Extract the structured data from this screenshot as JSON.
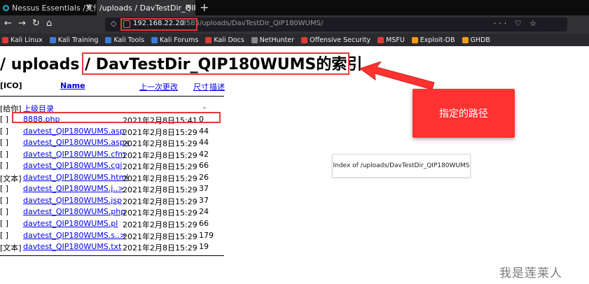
{
  "browser": {
    "tabs": [
      {
        "title": "Nessus Essentials /文件"
      },
      {
        "title": "/uploads / DavTestDir_QIP"
      }
    ],
    "url": {
      "host": "192.168.22.20",
      "rest": ":8585/uploads/DavTestDir_QIP180WUMS/"
    },
    "url_actions": "··· ♡ ☆",
    "bookmarks": [
      {
        "label": "Kali Linux",
        "color": "#e53935"
      },
      {
        "label": "Kali Training",
        "color": "#3b7ddd"
      },
      {
        "label": "Kali Tools",
        "color": "#3b7ddd"
      },
      {
        "label": "Kali Forums",
        "color": "#3b7ddd"
      },
      {
        "label": "Kali Docs",
        "color": "#e53935"
      },
      {
        "label": "NetHunter",
        "color": "#888888"
      },
      {
        "label": "Offensive Security",
        "color": "#e53935"
      },
      {
        "label": "MSFU",
        "color": "#e53935"
      },
      {
        "label": "Exploit-DB",
        "color": "#f39c12"
      },
      {
        "label": "GHDB",
        "color": "#f39c12"
      }
    ]
  },
  "page": {
    "heading": "/ uploads / DavTestDir_QIP180WUMS的索引",
    "columns": {
      "ico": "[ICO]",
      "name": "Name",
      "modified": "上一次更改",
      "size": "尺寸",
      "desc": "描述"
    },
    "parent": {
      "icon": "[给你]",
      "name": "上级目录",
      "size": "-"
    },
    "rows": [
      {
        "icon": "[ ]",
        "name": "8888.php",
        "date": "2021年2月8日15:41",
        "size": "0"
      },
      {
        "icon": "[ ]",
        "name": "davtest_QIP180WUMS.asp",
        "date": "2021年2月8日15:29",
        "size": "44"
      },
      {
        "icon": "[ ]",
        "name": "davtest_QIP180WUMS.aspx",
        "date": "2021年2月8日15:29",
        "size": "44"
      },
      {
        "icon": "[ ]",
        "name": "davtest_QIP180WUMS.cfm",
        "date": "2021年2月8日15:29",
        "size": "42"
      },
      {
        "icon": "[ ]",
        "name": "davtest_QIP180WUMS.cgi",
        "date": "2021年2月8日15:29",
        "size": "66"
      },
      {
        "icon": "[文本]",
        "name": "davtest_QIP180WUMS.html",
        "date": "2021年2月8日15:29",
        "size": "26"
      },
      {
        "icon": "[ ]",
        "name": "davtest_QIP180WUMS.j..>",
        "date": "2021年2月8日15:29",
        "size": "37"
      },
      {
        "icon": "[ ]",
        "name": "davtest_QIP180WUMS.jsp",
        "date": "2021年2月8日15:29",
        "size": "37"
      },
      {
        "icon": "[ ]",
        "name": "davtest_QIP180WUMS.php",
        "date": "2021年2月8日15:29",
        "size": "24"
      },
      {
        "icon": "[ ]",
        "name": "davtest_QIP180WUMS.pl",
        "date": "2021年2月8日15:29",
        "size": "66"
      },
      {
        "icon": "[ ]",
        "name": "davtest_QIP180WUMS.s..>",
        "date": "2021年2月8日15:29",
        "size": "179"
      },
      {
        "icon": "[文本]",
        "name": "davtest_QIP180WUMS.txt",
        "date": "2021年2月8日15:29",
        "size": "19"
      }
    ]
  },
  "annotation": {
    "callout": "指定的路径",
    "tooltip": "Index of /uploads/DavTestDir_QIP180WUMS",
    "watermark": "我是莲莱人",
    "highlight_color": "#e53935"
  }
}
